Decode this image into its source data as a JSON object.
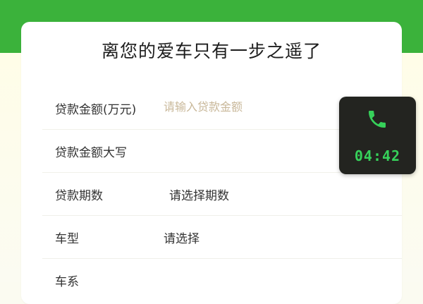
{
  "page": {
    "title": "离您的爱车只有一步之遥了"
  },
  "form": {
    "loan_amount": {
      "label": "贷款金额(万元)",
      "placeholder": "请输入贷款金额",
      "value": ""
    },
    "loan_amount_upper": {
      "label": "贷款金额大写",
      "value": ""
    },
    "loan_term": {
      "label": "贷款期数",
      "value": "请选择期数"
    },
    "car_model": {
      "label": "车型",
      "value": "请选择"
    },
    "car_series": {
      "label": "车系"
    }
  },
  "call": {
    "timer": "04:42",
    "icon": "phone-icon"
  },
  "colors": {
    "brand_green": "#3bb23b",
    "call_bg": "#232420",
    "call_accent": "#36d15a",
    "placeholder": "#c9b89a"
  }
}
